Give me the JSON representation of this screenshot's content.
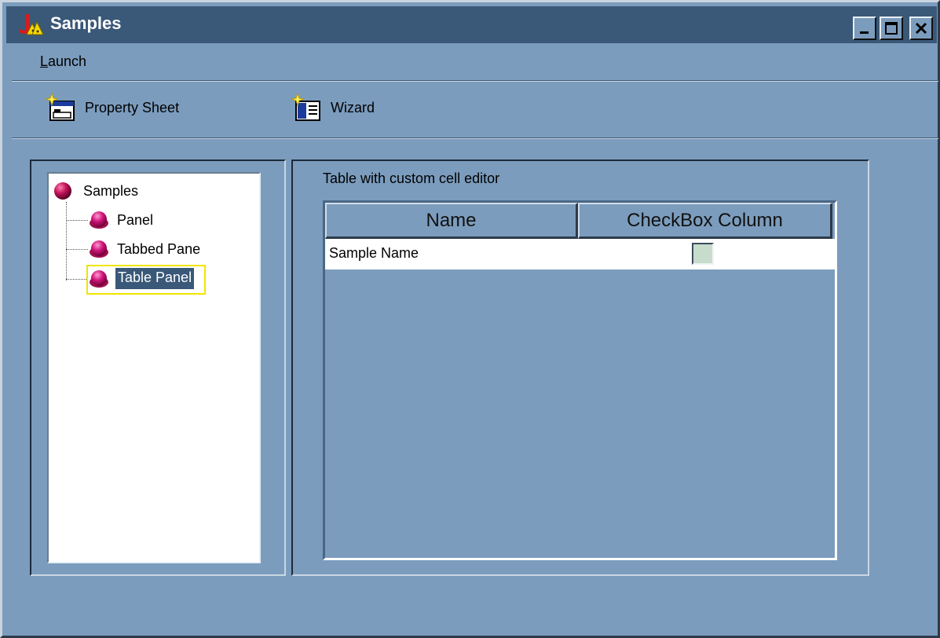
{
  "window": {
    "title": "Samples",
    "colors": {
      "titlebar": "#3a5878",
      "background": "#7b9cbd",
      "selection": "#3a5878",
      "tree_node_ball": "#c0135a"
    }
  },
  "menu": {
    "launch_mnemonic": "L",
    "launch_rest": "aunch"
  },
  "toolbar": {
    "property_sheet_label": "Property Sheet",
    "wizard_label": "Wizard"
  },
  "tree": {
    "root": "Samples",
    "children": [
      "Panel",
      "Tabbed Pane",
      "Table Panel"
    ],
    "selected": "Table Panel"
  },
  "content": {
    "caption": "Table with custom cell editor",
    "table": {
      "columns": [
        "Name",
        "CheckBox Column"
      ],
      "rows": [
        {
          "name": "Sample Name",
          "checked": false
        }
      ]
    }
  }
}
